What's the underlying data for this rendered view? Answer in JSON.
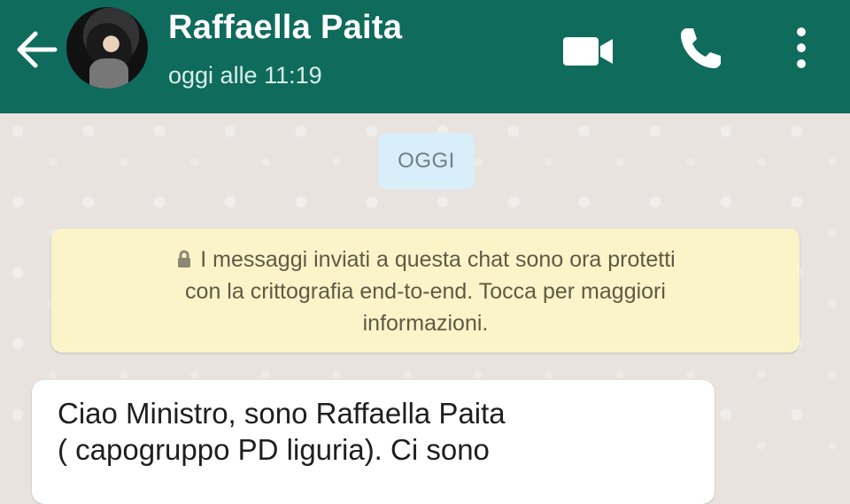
{
  "header": {
    "contact_name": "Raffaella Paita",
    "last_seen": "oggi alle 11:19",
    "colors": {
      "bar": "#0f6b5c",
      "text": "#ffffff"
    },
    "icons": [
      "back-arrow-icon",
      "video-call-icon",
      "phone-icon",
      "more-options-icon"
    ]
  },
  "chat": {
    "date_chip": "OGGI",
    "encryption_notice": {
      "lines": [
        "I messaggi inviati a questa chat sono ora protetti",
        "con la crittografia end-to-end. Tocca per maggiori",
        "informazioni."
      ],
      "icon": "lock-icon"
    },
    "messages": [
      {
        "lines": [
          "Ciao Ministro, sono Raffaella Paita",
          "( capogruppo PD liguria). Ci sono"
        ]
      }
    ]
  }
}
